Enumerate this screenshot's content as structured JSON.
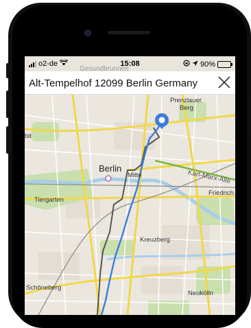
{
  "status_bar": {
    "carrier": "o2-de",
    "time": "15:08",
    "battery_level": "90%",
    "battery_fraction": 0.9,
    "icons": [
      "signal-icon",
      "wifi-icon",
      "orientation-lock-icon",
      "location-arrow-icon",
      "battery-icon"
    ]
  },
  "background_label": "Gesundbrunnen",
  "header": {
    "title": "Alt-Tempelhof 12099 Berlin Germany",
    "close_icon": "close-icon"
  },
  "map": {
    "labels": {
      "prenzlauer": "Prenzlauer",
      "berg": "Berg",
      "berlin": "Berlin",
      "mitte": "Mitte",
      "karl_marx": "Karl-Marx-Alle",
      "friedrich": "Friedrich",
      "tiergarten": "Tiergarten",
      "kreuzberg": "Kreuzberg",
      "schoeneberg": "Schöneberg",
      "neukoelln": "Neukölln",
      "edge_left": "bit"
    },
    "colors": {
      "route_primary": "#3b7ddd",
      "route_alternative": "#555555",
      "pin": "#3b7ddd",
      "park": "#c9dfae",
      "water": "#a8cde8",
      "major_road": "#f0d84a"
    }
  }
}
